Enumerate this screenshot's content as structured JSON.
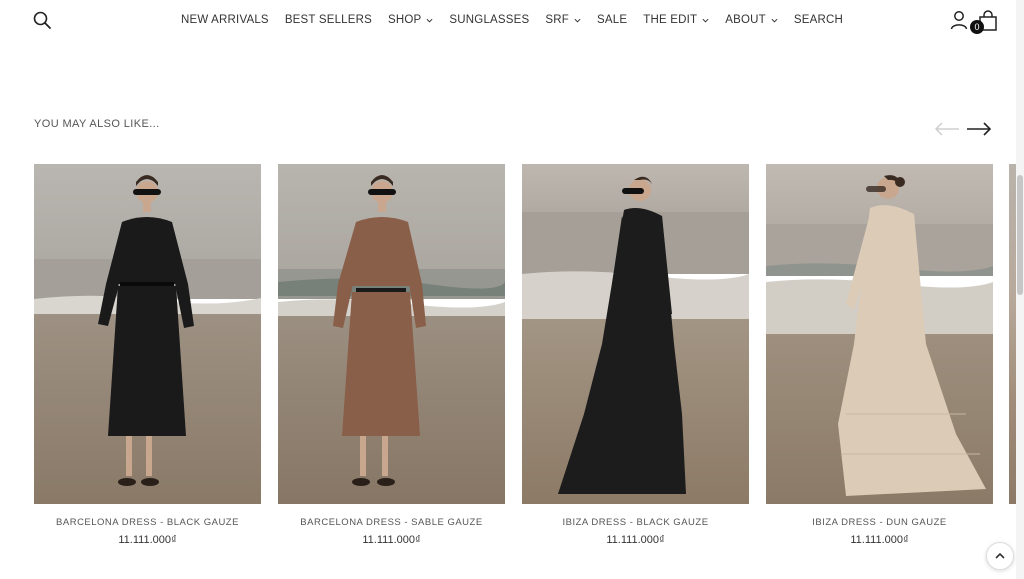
{
  "header": {
    "nav": [
      {
        "label": "NEW ARRIVALS",
        "has_dropdown": false
      },
      {
        "label": "BEST SELLERS",
        "has_dropdown": false
      },
      {
        "label": "SHOP",
        "has_dropdown": true
      },
      {
        "label": "SUNGLASSES",
        "has_dropdown": false
      },
      {
        "label": "SRF",
        "has_dropdown": true
      },
      {
        "label": "SALE",
        "has_dropdown": false
      },
      {
        "label": "THE EDIT",
        "has_dropdown": true
      },
      {
        "label": "ABOUT",
        "has_dropdown": true
      },
      {
        "label": "SEARCH",
        "has_dropdown": false
      }
    ],
    "cart_count": "0",
    "icons": {
      "search": "search-icon",
      "account": "user-icon",
      "cart": "shopping-bag-icon"
    }
  },
  "section": {
    "title": "YOU MAY ALSO LIKE...",
    "prev_icon": "arrow-left-icon",
    "next_icon": "arrow-right-icon"
  },
  "products": [
    {
      "name": "BARCELONA DRESS - BLACK GAUZE",
      "price": "11.111.000₫",
      "dress_color": "#1a1a1a"
    },
    {
      "name": "BARCELONA DRESS - SABLE GAUZE",
      "price": "11.111.000₫",
      "dress_color": "#8a5f49"
    },
    {
      "name": "IBIZA DRESS - BLACK GAUZE",
      "price": "11.111.000₫",
      "dress_color": "#1c1c1c"
    },
    {
      "name": "IBIZA DRESS - DUN GAUZE",
      "price": "11.111.000₫",
      "dress_color": "#dccbb6"
    }
  ],
  "colors": {
    "text": "#333333",
    "sky": "#bcb7b1",
    "sea": "#a7a39c",
    "sand": "#9b8a77"
  }
}
